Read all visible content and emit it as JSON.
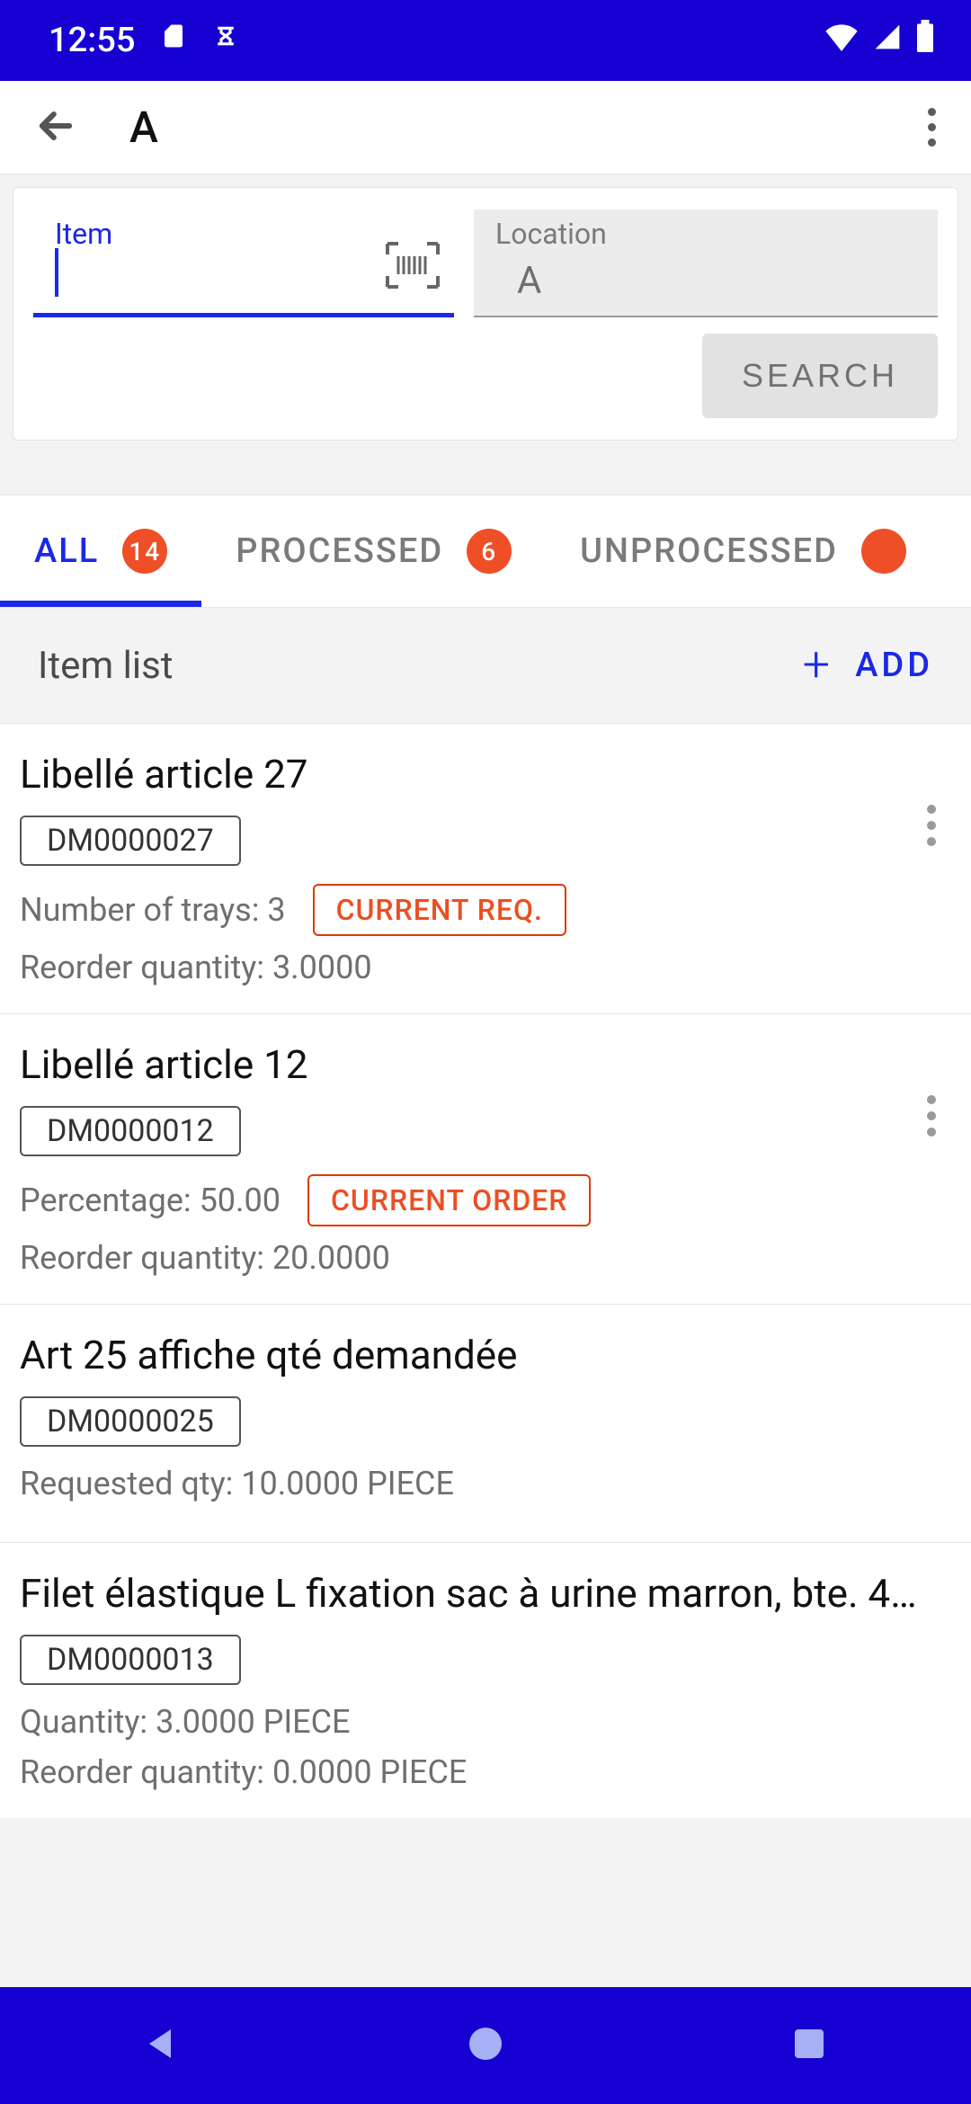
{
  "status_bar": {
    "time": "12:55"
  },
  "app_bar": {
    "title": "A"
  },
  "search": {
    "item_label": "Item",
    "item_value": "",
    "location_label": "Location",
    "location_value": "A",
    "button": "SEARCH"
  },
  "tabs": {
    "all": {
      "label": "ALL",
      "count": "14"
    },
    "processed": {
      "label": "PROCESSED",
      "count": "6"
    },
    "unprocessed": {
      "label": "UNPROCESSED"
    }
  },
  "list_header": {
    "title": "Item list",
    "add": "ADD"
  },
  "items": [
    {
      "title": "Libellé article 27",
      "code": "DM0000027",
      "line1": "Number of trays: 3",
      "chip": "CURRENT REQ.",
      "line2": "Reorder quantity: 3.0000",
      "has_overflow": true
    },
    {
      "title": "Libellé article 12",
      "code": "DM0000012",
      "line1": "Percentage: 50.00",
      "chip": "CURRENT ORDER",
      "line2": "Reorder quantity: 20.0000",
      "has_overflow": true
    },
    {
      "title": "Art 25 affiche qté demandée",
      "code": "DM0000025",
      "line1": "Requested qty: 10.0000 PIECE",
      "chip": "",
      "line2": "",
      "has_overflow": false
    },
    {
      "title": "Filet élastique L fixation sac à urine marron, bte. 4…",
      "code": "DM0000013",
      "line1": "Quantity: 3.0000 PIECE",
      "chip": "",
      "line2": "Reorder quantity: 0.0000 PIECE",
      "has_overflow": false
    }
  ]
}
